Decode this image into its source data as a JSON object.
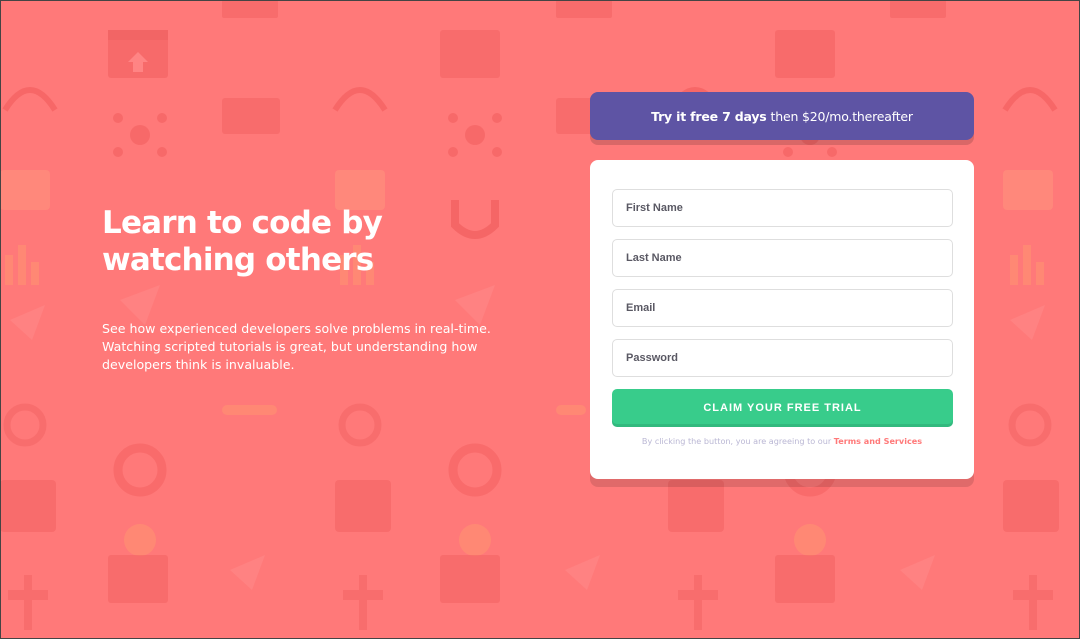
{
  "colors": {
    "background": "#ff7979",
    "promo": "#5e54a4",
    "card": "#ffffff",
    "button": "#38cc8b",
    "link": "#ff7979",
    "muted": "#bab7d4"
  },
  "hero": {
    "title_line1": "Learn to code by",
    "title_line2": "watching others",
    "description": "See how experienced developers solve problems in real-time. Watching scripted tutorials is great, but understanding how developers think is invaluable."
  },
  "promo": {
    "strong": "Try it free 7 days",
    "rest": "then $20/mo.thereafter"
  },
  "form": {
    "first_name_placeholder": "First Name",
    "last_name_placeholder": "Last Name",
    "email_placeholder": "Email",
    "password_placeholder": "Password",
    "submit_label": "CLAIM YOUR FREE TRIAL",
    "terms_prefix": "By clicking the button, you are agreeing to our",
    "terms_link": "Terms and Services"
  },
  "background_icons": [
    "browser-window-icon",
    "toolbox-icon",
    "headset-icon",
    "network-icon",
    "thumbs-up-icon",
    "bar-chart-icon",
    "magnet-icon",
    "rocket-icon",
    "gear-icon",
    "key-icon",
    "lifebuoy-icon",
    "calendar-icon",
    "lightbulb-icon",
    "flowchart-icon"
  ]
}
